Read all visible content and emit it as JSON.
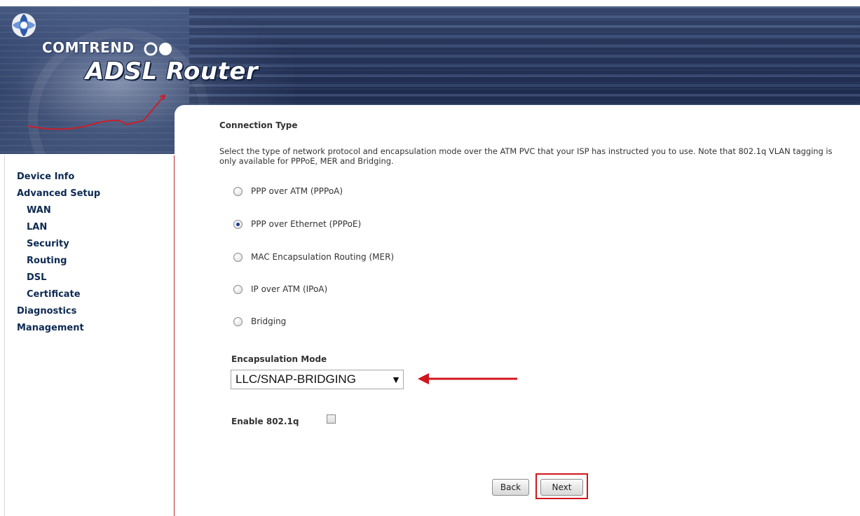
{
  "header": {
    "brand": "COMTREND",
    "product": "ADSL Router"
  },
  "nav": {
    "items": [
      {
        "label": "Device Info",
        "level": 0
      },
      {
        "label": "Advanced Setup",
        "level": 0
      },
      {
        "label": "WAN",
        "level": 1
      },
      {
        "label": "LAN",
        "level": 1
      },
      {
        "label": "Security",
        "level": 1
      },
      {
        "label": "Routing",
        "level": 1
      },
      {
        "label": "DSL",
        "level": 1
      },
      {
        "label": "Certificate",
        "level": 1
      },
      {
        "label": "Diagnostics",
        "level": 0
      },
      {
        "label": "Management",
        "level": 0
      }
    ]
  },
  "main": {
    "heading": "Connection Type",
    "description": "Select the type of network protocol and encapsulation mode over the ATM PVC that your ISP has instructed you to use. Note that 802.1q VLAN tagging is only available for PPPoE, MER and Bridging.",
    "options": [
      {
        "label": "PPP over ATM (PPPoA)",
        "selected": false
      },
      {
        "label": "PPP over Ethernet (PPPoE)",
        "selected": true
      },
      {
        "label": "MAC Encapsulation Routing (MER)",
        "selected": false
      },
      {
        "label": "IP over ATM (IPoA)",
        "selected": false
      },
      {
        "label": "Bridging",
        "selected": false
      }
    ],
    "encapsulation": {
      "label": "Encapsulation Mode",
      "value": "LLC/SNAP-BRIDGING"
    },
    "vlan": {
      "label": "Enable 802.1q",
      "checked": false
    },
    "buttons": {
      "back": "Back",
      "next": "Next"
    }
  },
  "colors": {
    "nav_text": "#0d2a52",
    "annotation_red": "#d0161e",
    "banner_blue": "#2f4068"
  },
  "icons": [
    "logo-swirl-icon",
    "dropdown-caret-icon",
    "annotation-arrow-icon"
  ]
}
